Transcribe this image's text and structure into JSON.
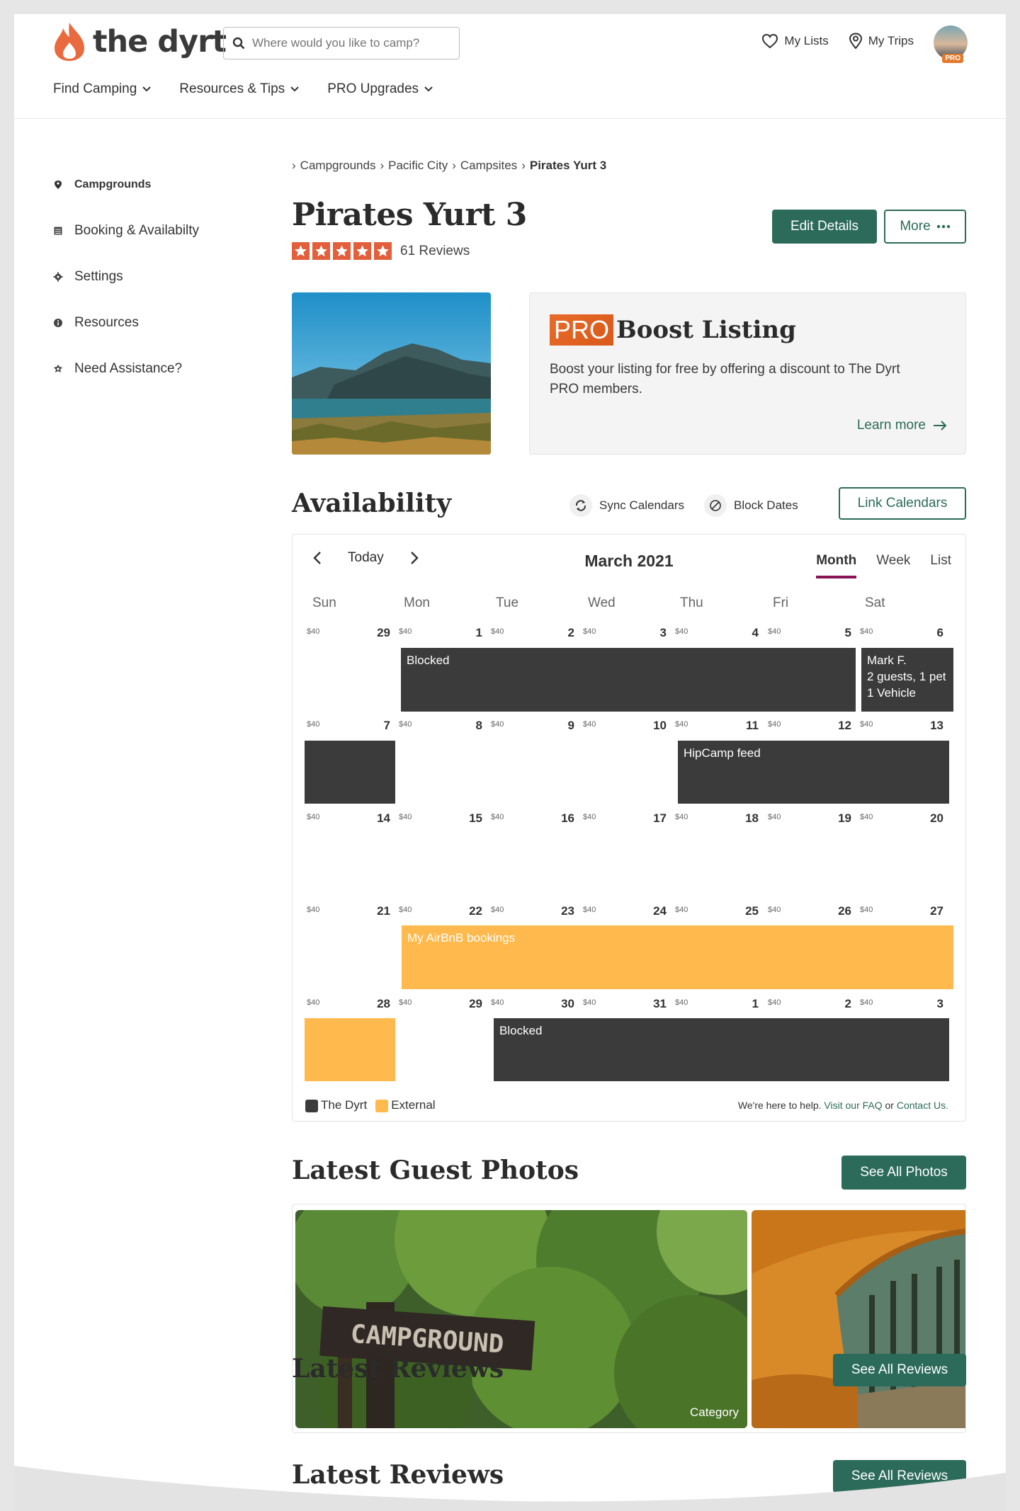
{
  "header": {
    "logo_text": "the dyrt",
    "search_placeholder": "Where would you like to camp?",
    "my_lists": "My Lists",
    "my_trips": "My Trips",
    "pro_badge": "PRO"
  },
  "nav": [
    "Find Camping",
    "Resources & Tips",
    "PRO Upgrades"
  ],
  "sidebar": [
    {
      "label": "Campgrounds",
      "icon": "pin-icon"
    },
    {
      "label": "Booking & Availabilty",
      "icon": "calendar-icon"
    },
    {
      "label": "Settings",
      "icon": "gear-icon"
    },
    {
      "label": "Resources",
      "icon": "info-icon"
    },
    {
      "label": "Need Assistance?",
      "icon": "help-icon"
    }
  ],
  "breadcrumb": [
    "Campgrounds",
    "Pacific City",
    "Campsites",
    "Pirates Yurt 3"
  ],
  "listing": {
    "title": "Pirates Yurt 3",
    "rating": 5,
    "reviews": "61 Reviews",
    "edit_label": "Edit Details",
    "more_label": "More"
  },
  "boost": {
    "pro": "PRO",
    "heading": "Boost Listing",
    "text": "Boost your listing for free by offering a discount to The Dyrt PRO members.",
    "link": "Learn more"
  },
  "availability": {
    "title": "Availability",
    "sync": "Sync Calendars",
    "block": "Block Dates",
    "link": "Link Calendars"
  },
  "calendar": {
    "today": "Today",
    "month": "March 2021",
    "views": [
      "Month",
      "Week",
      "List"
    ],
    "dow": [
      "Sun",
      "Mon",
      "Tue",
      "Wed",
      "Thu",
      "Fri",
      "Sat"
    ],
    "price": "$40",
    "weeks": [
      [
        "29",
        "1",
        "2",
        "3",
        "4",
        "5",
        "6"
      ],
      [
        "7",
        "8",
        "9",
        "10",
        "11",
        "12",
        "13"
      ],
      [
        "14",
        "15",
        "16",
        "17",
        "18",
        "19",
        "20"
      ],
      [
        "21",
        "22",
        "23",
        "24",
        "25",
        "26",
        "27"
      ],
      [
        "28",
        "29",
        "30",
        "31",
        "1",
        "2",
        "3"
      ]
    ],
    "events": {
      "blocked1": "Blocked",
      "mark_name": "Mark F.",
      "mark_guests": "2 guests, 1 pet",
      "mark_vehicle": "1 Vehicle",
      "hipcamp": "HipCamp feed",
      "airbnb": "My AirBnB bookings",
      "blocked2": "Blocked"
    },
    "legend": [
      "The Dyrt",
      "External"
    ],
    "legend_colors": [
      "#3c3b3c",
      "#ffb94c"
    ],
    "help_prefix": "We're here to help.",
    "help_faq": "Visit our FAQ",
    "help_or": "or",
    "help_contact": "Contact Us."
  },
  "photos": {
    "title": "Latest Guest Photos",
    "button": "See All Photos",
    "sign_text": "CAMPGROUND",
    "category": "Category"
  },
  "reviews_section": {
    "title": "Latest Reviews",
    "button": "See All Reviews"
  },
  "colors": {
    "brand_green": "#2c6b5a",
    "brand_orange": "#e35f3c",
    "active_tab": "#8a1155"
  }
}
